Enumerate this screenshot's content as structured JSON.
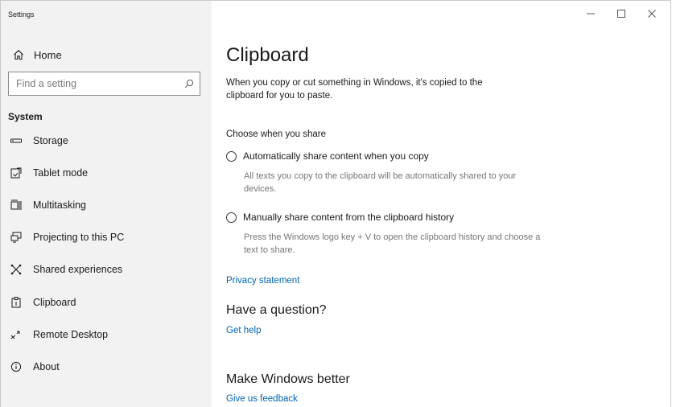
{
  "app": {
    "title": "Settings"
  },
  "sidebar": {
    "home_label": "Home",
    "search_placeholder": "Find a setting",
    "section_label": "System",
    "items": [
      {
        "label": "Storage",
        "icon": "storage-icon"
      },
      {
        "label": "Tablet mode",
        "icon": "tablet-mode-icon"
      },
      {
        "label": "Multitasking",
        "icon": "multitasking-icon"
      },
      {
        "label": "Projecting to this PC",
        "icon": "projecting-icon"
      },
      {
        "label": "Shared experiences",
        "icon": "shared-experiences-icon"
      },
      {
        "label": "Clipboard",
        "icon": "clipboard-icon"
      },
      {
        "label": "Remote Desktop",
        "icon": "remote-desktop-icon"
      },
      {
        "label": "About",
        "icon": "info-icon"
      }
    ]
  },
  "main": {
    "title": "Clipboard",
    "description": "When you copy or cut something in Windows, it's copied to the clipboard for you to paste.",
    "share_section_label": "Choose when you share",
    "options": [
      {
        "label": "Automatically share content when you copy",
        "description": "All texts you copy to the clipboard will be automatically shared to your devices.",
        "selected": false
      },
      {
        "label": "Manually share content from the clipboard history",
        "description": "Press the Windows logo key + V to open the clipboard history and choose a text to share.",
        "selected": false
      }
    ],
    "privacy_link": "Privacy statement",
    "question_heading": "Have a question?",
    "get_help_link": "Get help",
    "better_heading": "Make Windows better",
    "feedback_link": "Give us feedback"
  },
  "colors": {
    "sidebar_bg": "#f2f2f2",
    "accent_link": "#0063b1",
    "secondary_text": "#767676"
  }
}
